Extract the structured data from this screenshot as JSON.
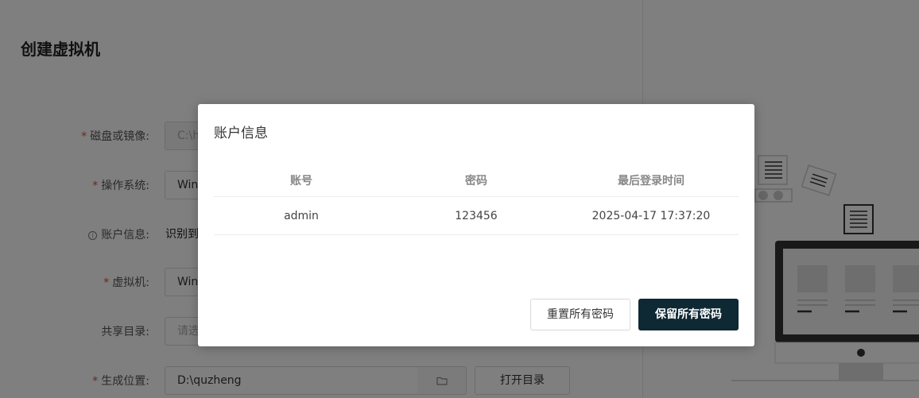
{
  "page": {
    "title": "创建虚拟机"
  },
  "form": {
    "disk": {
      "label": "磁盘或镜像:",
      "value": "C:\\h"
    },
    "os": {
      "label": "操作系统:",
      "value": "Wind"
    },
    "account": {
      "label": "账户信息:",
      "value": "识别到"
    },
    "vm": {
      "label": "虚拟机:",
      "value": "Wind"
    },
    "share": {
      "label": "共享目录:",
      "placeholder": "请选"
    },
    "location": {
      "label": "生成位置:",
      "value": "D:\\quzheng",
      "open_label": "打开目录"
    }
  },
  "modal": {
    "title": "账户信息",
    "columns": [
      "账号",
      "密码",
      "最后登录时间"
    ],
    "rows": [
      [
        "admin",
        "123456",
        "2025-04-17 17:37:20"
      ]
    ],
    "reset_label": "重置所有密码",
    "keep_label": "保留所有密码"
  },
  "colors": {
    "primary_button": "#0e2834",
    "required_star": "#e0483a"
  },
  "icons": {
    "folder": "folder-icon",
    "info": "info-icon"
  }
}
